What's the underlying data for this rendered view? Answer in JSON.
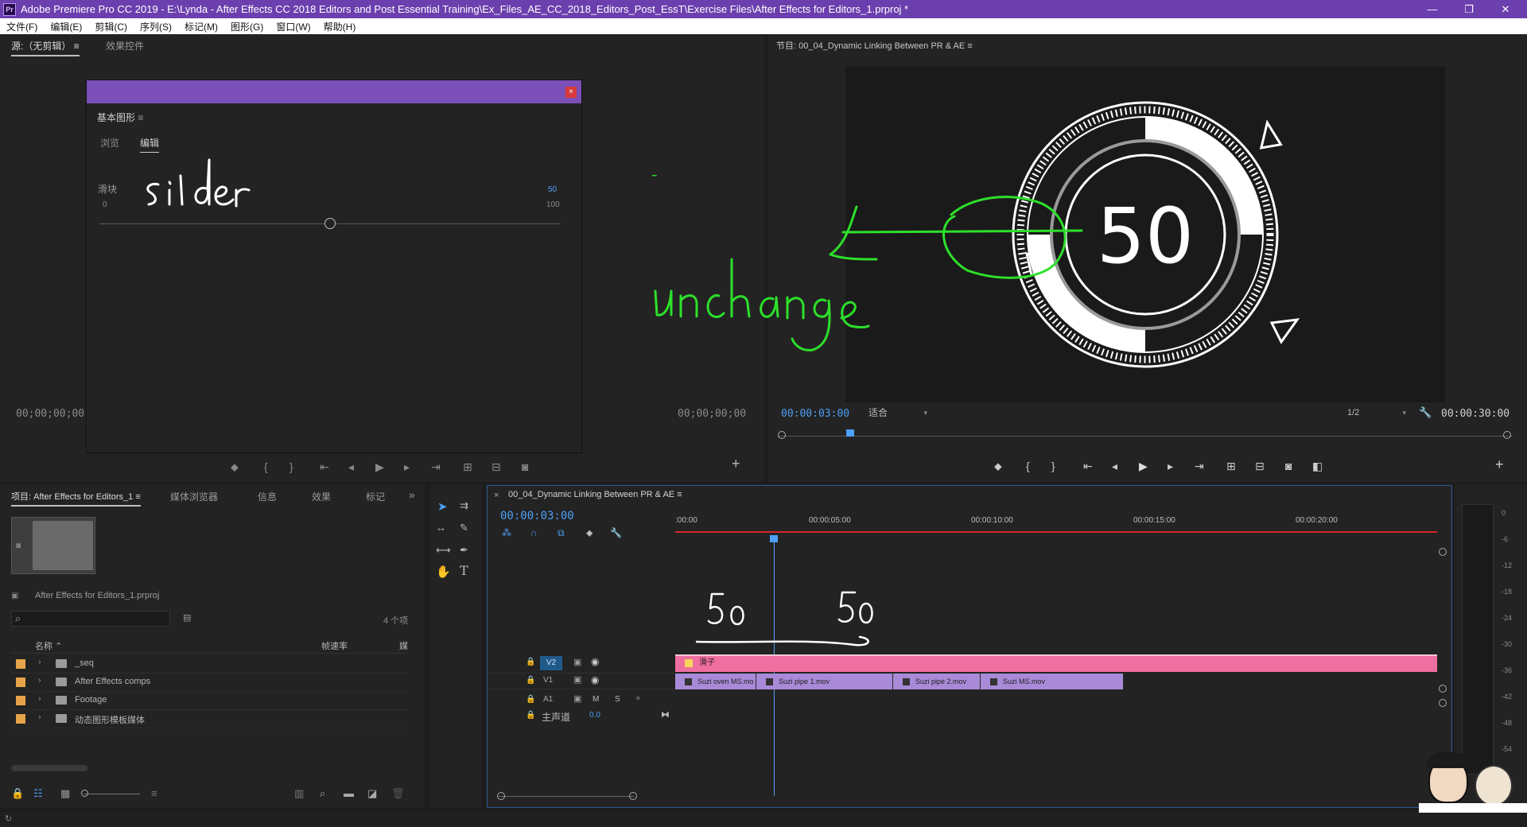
{
  "window": {
    "title": "Adobe Premiere Pro CC 2019 - E:\\Lynda - After Effects CC 2018 Editors and Post Essential Training\\Ex_Files_AE_CC_2018_Editors_Post_EssT\\Exercise Files\\After Effects for Editors_1.prproj *",
    "app_badge": "Pr",
    "minimize": "—",
    "maximize": "❐",
    "close": "✕"
  },
  "menu": [
    "文件(F)",
    "编辑(E)",
    "剪辑(C)",
    "序列(S)",
    "标记(M)",
    "图形(G)",
    "窗口(W)",
    "帮助(H)"
  ],
  "source_panel": {
    "tab_source": "源:（无剪辑）",
    "tab_effects": "效果控件",
    "timecode_left": "00;00;00;00",
    "timecode_right": "00;00;00;00",
    "add_button": "+"
  },
  "essential_graphics": {
    "close": "×",
    "title": "基本图形",
    "tab_browse": "浏览",
    "tab_edit": "编辑",
    "slider_label": "滑块",
    "slider_min": "0",
    "slider_value": "50",
    "slider_max": "100",
    "slider_fraction": 0.5,
    "annotation": "silder"
  },
  "program_monitor": {
    "title": "节目: 00_04_Dynamic Linking Between PR & AE",
    "timecode": "00:00:03:00",
    "fit_option": "适合",
    "resolution": "1/2",
    "duration": "00:00:30:00",
    "dial_value": "50",
    "annotation": "unchange",
    "add_button": "+"
  },
  "project_panel": {
    "tabs": [
      "项目: After Effects for Editors_1",
      "媒体浏览器",
      "信息",
      "效果",
      "标记"
    ],
    "overflow": "»",
    "project_file": "After Effects for Editors_1.prproj",
    "item_count": "4 个项",
    "col_name": "名称",
    "col_framerate": "帧速率",
    "col_media": "媒",
    "items": [
      "_seq",
      "After Effects comps",
      "Footage",
      "动态图形模板媒体"
    ]
  },
  "timeline": {
    "close": "×",
    "sequence_name": "00_04_Dynamic Linking Between PR & AE",
    "timecode": "00:00:03:00",
    "ruler": [
      ":00:00",
      "00:00:05:00",
      "00:00:10:00",
      "00:00:15:00",
      "00:00:20:00"
    ],
    "tracks": {
      "v2": "V2",
      "v1": "V1",
      "a1": "A1",
      "m": "M",
      "s": "S",
      "master": "主声道",
      "master_value": "0.0"
    },
    "v2_clip": "滑子",
    "v1_clips": [
      "Suzi oven MS.mo",
      "Suzi pipe 1.mov",
      "Suzi pipe 2.mov",
      "Suzi MS.mov"
    ],
    "annotation_left": "50",
    "annotation_right": "50"
  },
  "audio_meter": {
    "scale": [
      "0",
      "-6",
      "-12",
      "-18",
      "-24",
      "-30",
      "-36",
      "-42",
      "-48",
      "-54"
    ]
  },
  "colors": {
    "title_bar": "#6c3fae",
    "timecode_blue": "#4d9ff7",
    "annotation_green": "#2de02a",
    "clip_pink": "#ef6fa0",
    "clip_purple": "#a98ad8",
    "folder_orange": "#e7a34a",
    "playhead_red": "#d9262d"
  }
}
